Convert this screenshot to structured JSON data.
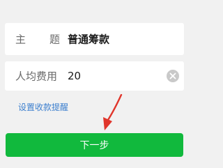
{
  "form": {
    "subject_label_chars": [
      "主",
      "题"
    ],
    "subject_value": "普通筹款",
    "amount_label": "人均费用",
    "amount_value": "20",
    "clear_icon": "clear-circle-icon"
  },
  "link_text": "设置收款提醒",
  "next_button_label": "下一步",
  "annotation": {
    "arrow_icon": "red-arrow-icon",
    "arrow_color": "#e0352b"
  },
  "colors": {
    "accent_green": "#11b93d",
    "link_blue": "#3c7fce",
    "background": "#f1f1f1"
  }
}
